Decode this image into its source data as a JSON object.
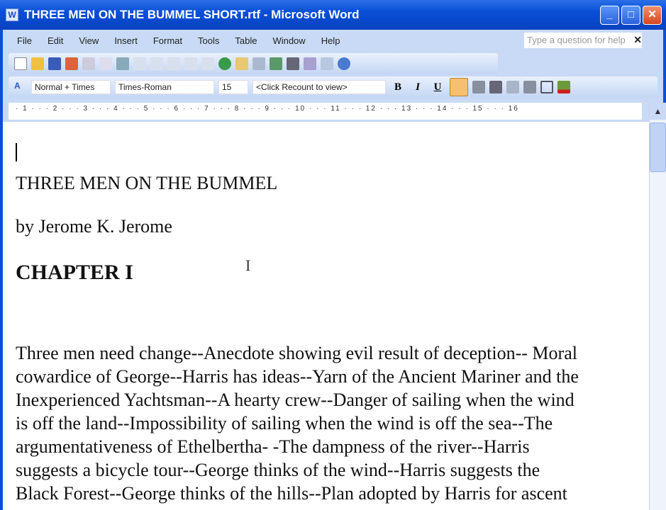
{
  "window": {
    "title": "THREE MEN ON THE BUMMEL SHORT.rtf - Microsoft Word",
    "minimize": "_",
    "maximize": "□",
    "close": "✕"
  },
  "menu": [
    "File",
    "Edit",
    "View",
    "Insert",
    "Format",
    "Tools",
    "Table",
    "Window",
    "Help"
  ],
  "help": {
    "placeholder": "Type a question for help",
    "close": "✕"
  },
  "formatting": {
    "style": "Normal + Times",
    "font": "Times-Roman",
    "size": "15",
    "recount": "<Click Recount to view>",
    "bold": "B",
    "italic": "I",
    "underline": "U"
  },
  "ruler": "· 1 · · · 2 · · · 3 · · · 4 · · · 5 · · · 6 · · · 7 · · · 8 · · · 9 · · · 10 · · · 11 · · · 12 · · · 13 · · · 14 · · · 15 · · · 16",
  "document": {
    "title": "THREE MEN ON THE BUMMEL",
    "author": "by Jerome K. Jerome",
    "chapter": "CHAPTER I",
    "lines": [
      "Three men need change--Anecdote showing evil result of deception-- Moral",
      "cowardice of George--Harris has ideas--Yarn of the Ancient Mariner and the",
      "Inexperienced Yachtsman--A hearty crew--Danger of sailing when the wind",
      "is off the land--Impossibility of sailing when the wind is off the sea--The",
      "argumentativeness of Ethelbertha- -The dampness of the river--Harris",
      "suggests a bicycle tour--George thinks of the wind--Harris suggests the",
      "Black Forest--George thinks of the hills--Plan adopted by Harris for ascent"
    ]
  }
}
